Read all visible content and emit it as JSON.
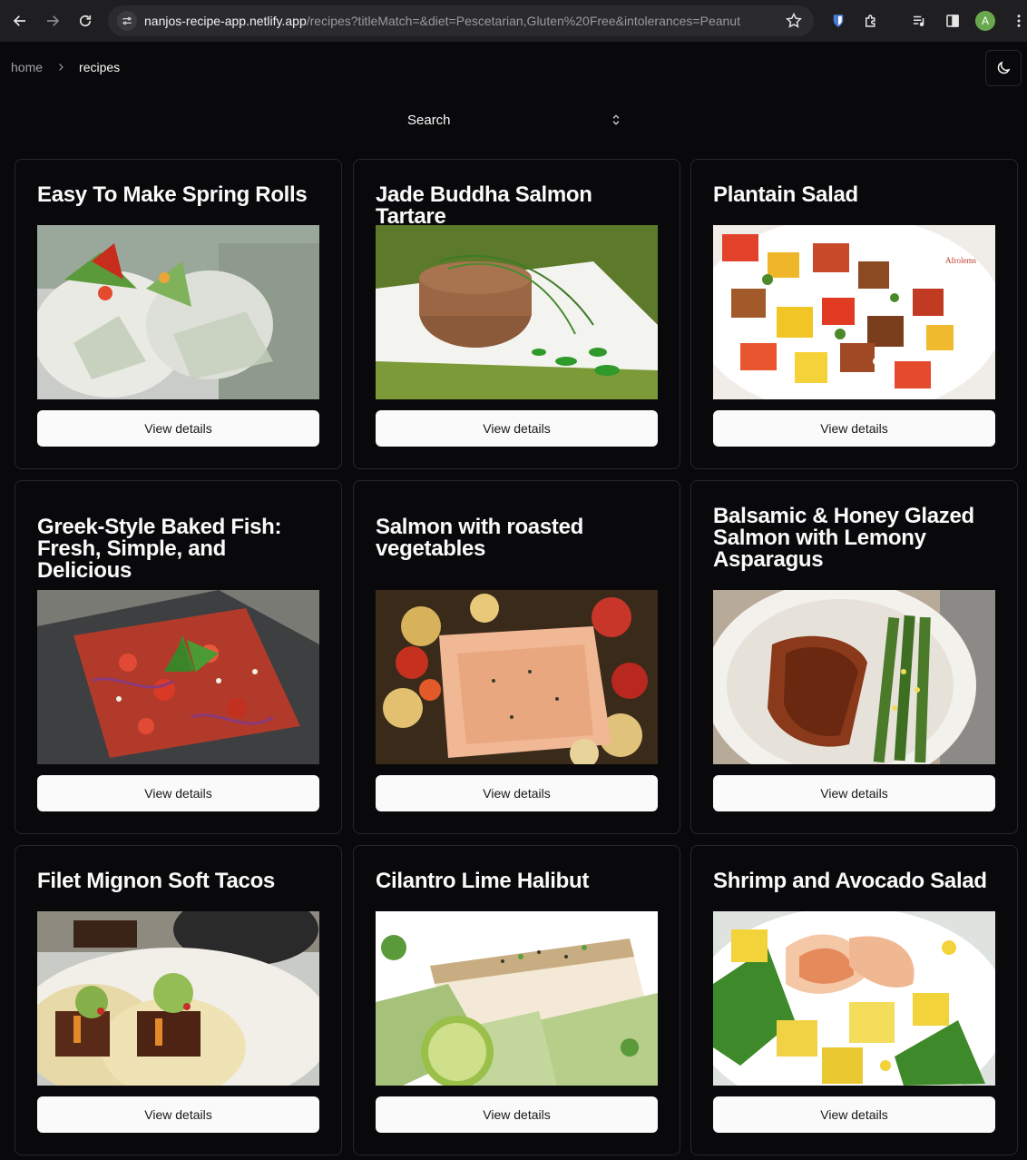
{
  "browser": {
    "url_host": "nanjos-recipe-app.netlify.app",
    "url_path": "/recipes?titleMatch=&diet=Pescetarian,Gluten%20Free&intolerances=Peanut",
    "profile_initial": "A"
  },
  "breadcrumb": {
    "home": "home",
    "current": "recipes"
  },
  "search": {
    "label": "Search"
  },
  "recipes": [
    {
      "title": "Easy To Make Spring Rolls",
      "button": "View details"
    },
    {
      "title": "Jade Buddha Salmon Tartare",
      "button": "View details"
    },
    {
      "title": "Plantain Salad",
      "button": "View details",
      "watermark": "Afrolems"
    },
    {
      "title": "Greek-Style Baked Fish: Fresh, Simple, and Delicious",
      "button": "View details"
    },
    {
      "title": "Salmon with roasted vegetables",
      "button": "View details"
    },
    {
      "title": "Balsamic & Honey Glazed Salmon with Lemony Asparagus",
      "button": "View details"
    },
    {
      "title": "Filet Mignon Soft Tacos",
      "button": "View details"
    },
    {
      "title": "Cilantro Lime Halibut",
      "button": "View details"
    },
    {
      "title": "Shrimp and Avocado Salad",
      "button": "View details"
    }
  ]
}
